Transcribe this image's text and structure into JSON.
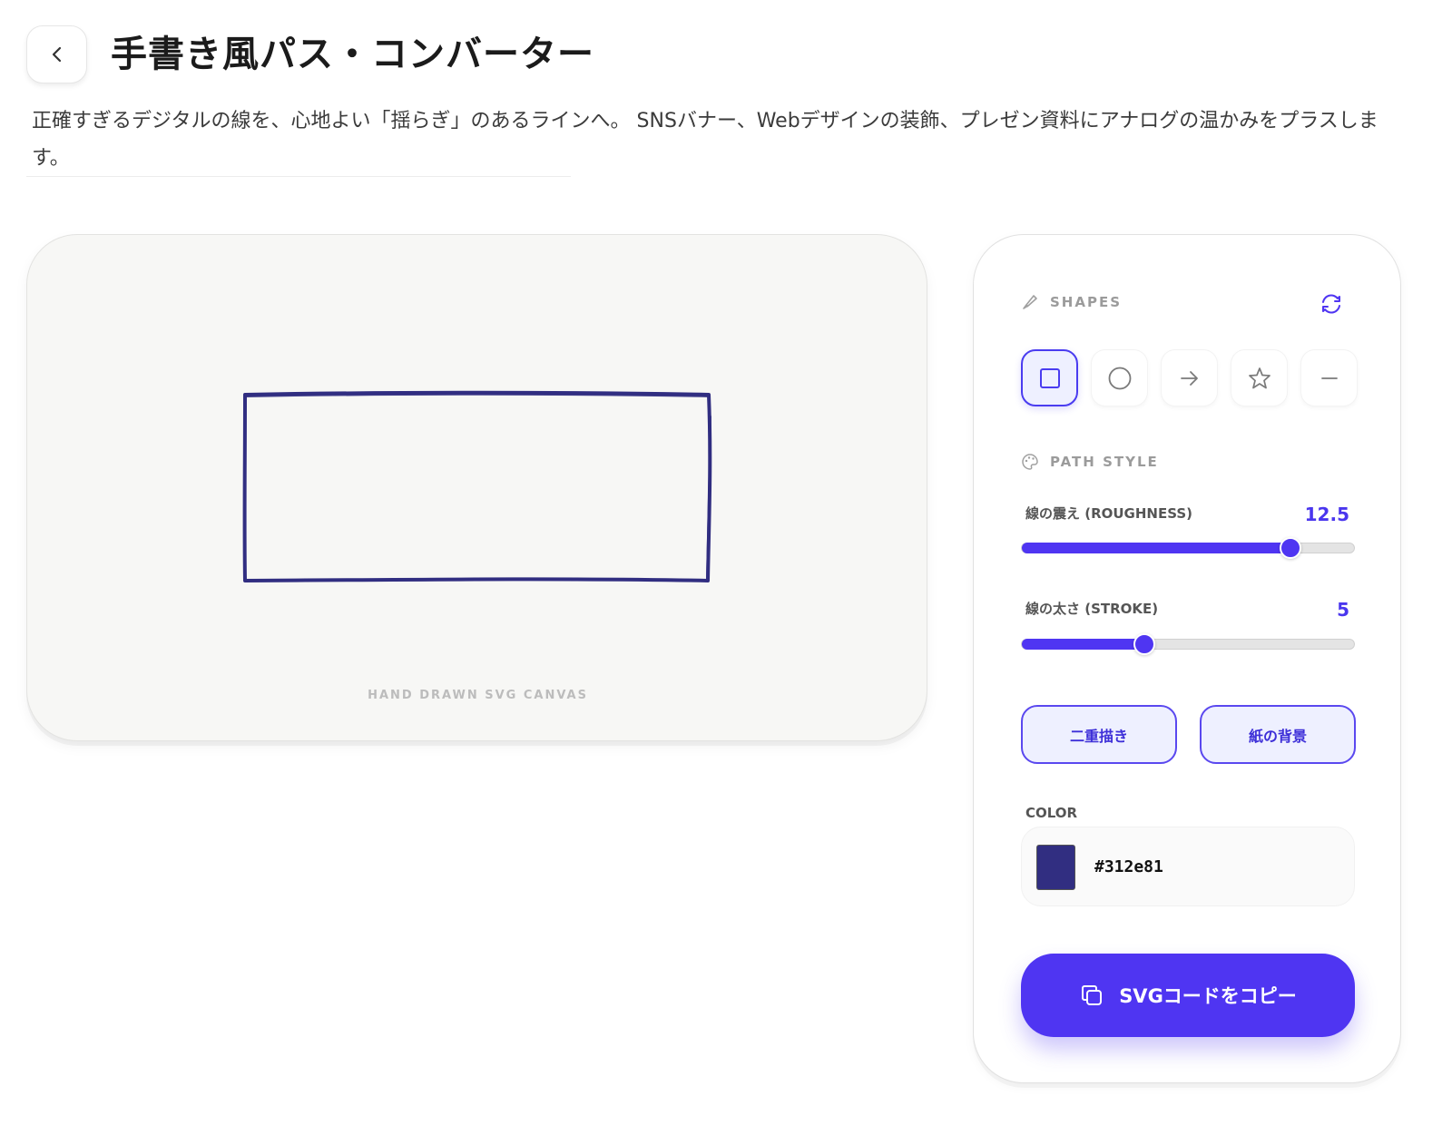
{
  "header": {
    "title": "手書き風パス・コンバーター",
    "description": "正確すぎるデジタルの線を、心地よい「揺らぎ」のあるラインへ。 SNSバナー、Webデザインの装飾、プレゼン資料にアナログの温かみをプラスします。",
    "back_icon": "chevron-left-icon"
  },
  "canvas": {
    "caption": "HAND DRAWN SVG CANVAS",
    "background": "#f7f7f5",
    "stroke_color": "#312e81",
    "shape": "rectangle"
  },
  "panel": {
    "shapes_section": {
      "label": "SHAPES",
      "icon": "brush-icon",
      "refresh_icon": "refresh-icon",
      "options": [
        {
          "name": "rectangle",
          "icon": "square-icon",
          "selected": true
        },
        {
          "name": "circle",
          "icon": "circle-icon",
          "selected": false
        },
        {
          "name": "arrow",
          "icon": "arrow-right-icon",
          "selected": false
        },
        {
          "name": "star",
          "icon": "star-icon",
          "selected": false
        },
        {
          "name": "line",
          "icon": "line-icon",
          "selected": false
        }
      ]
    },
    "path_style_section": {
      "label": "PATH STYLE",
      "icon": "palette-icon",
      "roughness": {
        "label": "線の震え (ROUGHNESS)",
        "value": "12.5",
        "fraction": 0.81
      },
      "stroke": {
        "label": "線の太さ (STROKE)",
        "value": "5",
        "fraction": 0.37
      }
    },
    "toggles": {
      "double_draw": "二重描き",
      "paper_bg": "紙の背景"
    },
    "color": {
      "label": "COLOR",
      "value": "#312e81"
    },
    "copy_button": {
      "label": "SVGコードをコピー",
      "icon": "copy-icon"
    },
    "accent": "#4f35f2"
  }
}
